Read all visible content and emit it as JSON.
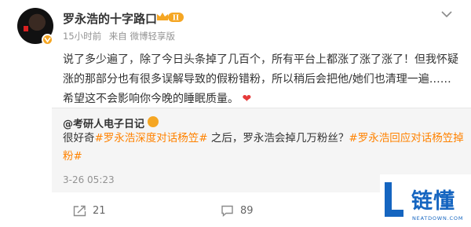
{
  "post": {
    "author": "罗永浩的十字路口",
    "level_badge": "II",
    "time": "15小时前",
    "source": "来自 微博轻享版",
    "text": "说了多少遍了，除了今日头条掉了几百个，所有平台上都涨了涨了涨了！但我怀疑涨的那部分也有很多误解导致的假粉错粉，所以稍后会把他/她们也清理一遍……希望这不会影响你今晚的睡眠质量。",
    "heart": "❤"
  },
  "repost": {
    "author": "@考研人电子日记",
    "text_prefix": "很好奇",
    "tag1": "#罗永浩深度对话杨笠#",
    "text_middle": " 之后，罗永浩会掉几万粉丝？",
    "tag2": "#罗永浩回应对话杨笠掉粉#",
    "time": "3-26 05:23"
  },
  "actions": {
    "repost_count": "21",
    "comment_count": "89"
  },
  "watermark": {
    "brand": "链懂",
    "site": "NEATDOWN.COM"
  },
  "colors": {
    "tag": "#ff8200",
    "gold": "#f5a623",
    "watermark": "#1565c0"
  }
}
